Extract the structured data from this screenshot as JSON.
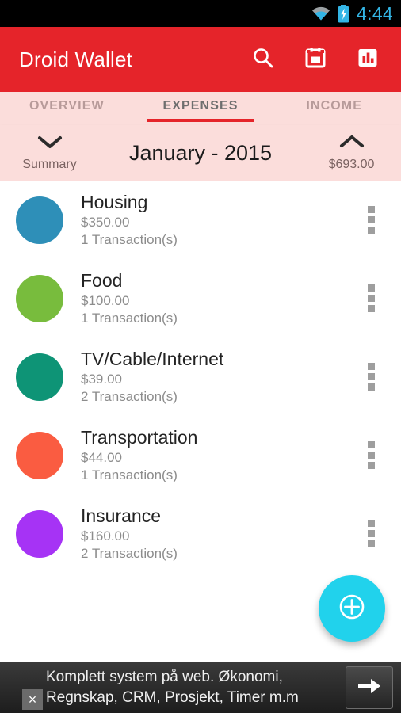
{
  "status_bar": {
    "wifi_icon": "wifi-icon",
    "battery_icon": "battery-charging-icon",
    "time": "4:44",
    "accent_color": "#33b5e5"
  },
  "app_bar": {
    "title": "Droid Wallet",
    "background_color": "#e5242a",
    "actions": [
      {
        "name": "search-icon",
        "label": "Search"
      },
      {
        "name": "calendar-icon",
        "label": "Calendar"
      },
      {
        "name": "bar-chart-icon",
        "label": "Reports"
      }
    ]
  },
  "tabs": {
    "background_color": "#fbdddb",
    "indicator_color": "#e5242a",
    "items": [
      {
        "label": "OVERVIEW",
        "active": false
      },
      {
        "label": "EXPENSES",
        "active": true
      },
      {
        "label": "INCOME",
        "active": false
      }
    ]
  },
  "month_bar": {
    "left_icon": "chevron-down-icon",
    "left_label": "Summary",
    "month": "January - 2015",
    "right_icon": "chevron-up-icon",
    "right_label": "$693.00"
  },
  "expenses": [
    {
      "category": "Housing",
      "amount": "$350.00",
      "transactions": "1 Transaction(s)",
      "color": "#2e8fb8"
    },
    {
      "category": "Food",
      "amount": "$100.00",
      "transactions": "1 Transaction(s)",
      "color": "#78bc3d"
    },
    {
      "category": "TV/Cable/Internet",
      "amount": "$39.00",
      "transactions": "2 Transaction(s)",
      "color": "#0e9476"
    },
    {
      "category": "Transportation",
      "amount": "$44.00",
      "transactions": "1 Transaction(s)",
      "color": "#fa5c41"
    },
    {
      "category": "Insurance",
      "amount": "$160.00",
      "transactions": "2 Transaction(s)",
      "color": "#a633f5"
    }
  ],
  "fab": {
    "icon": "add-circle-icon",
    "color": "#21d2ec"
  },
  "ad": {
    "line1": "Komplett system på web. Økonomi,",
    "line2": "Regnskap, CRM, Prosjekt, Timer m.m",
    "cta_icon": "arrow-right-icon",
    "close_label": "×"
  }
}
